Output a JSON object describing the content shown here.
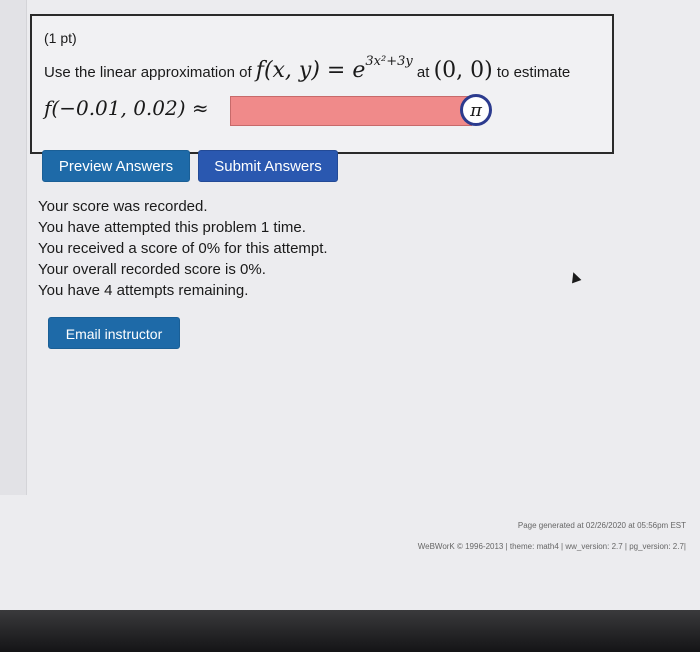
{
  "problem": {
    "points": "(1 pt)",
    "question_prefix": "Use the linear approximation of",
    "function_lhs": "f(x, y) = e",
    "function_exp": "3x²+3y",
    "point_label": "at",
    "point": "(0, 0)",
    "question_suffix": "to estimate",
    "estimate_expr": "f(−0.01, 0.02) ≈",
    "answer_value": "",
    "pi_symbol": "π"
  },
  "buttons": {
    "preview": "Preview Answers",
    "submit": "Submit Answers",
    "email": "Email instructor"
  },
  "status": {
    "line1": "Your score was recorded.",
    "line2": "You have attempted this problem 1 time.",
    "line3": "You received a score of 0% for this attempt.",
    "line4": "Your overall recorded score is 0%.",
    "line5": "You have 4 attempts remaining."
  },
  "footer": {
    "generated": "Page generated at 02/26/2020 at 05:56pm EST",
    "version": "WeBWorK © 1996-2013 | theme: math4 | ww_version: 2.7 | pg_version: 2.7|"
  },
  "colors": {
    "answer_bg": "#f08a8a",
    "button_blue": "#1e6aa8",
    "pi_border": "#2c3b8e"
  }
}
